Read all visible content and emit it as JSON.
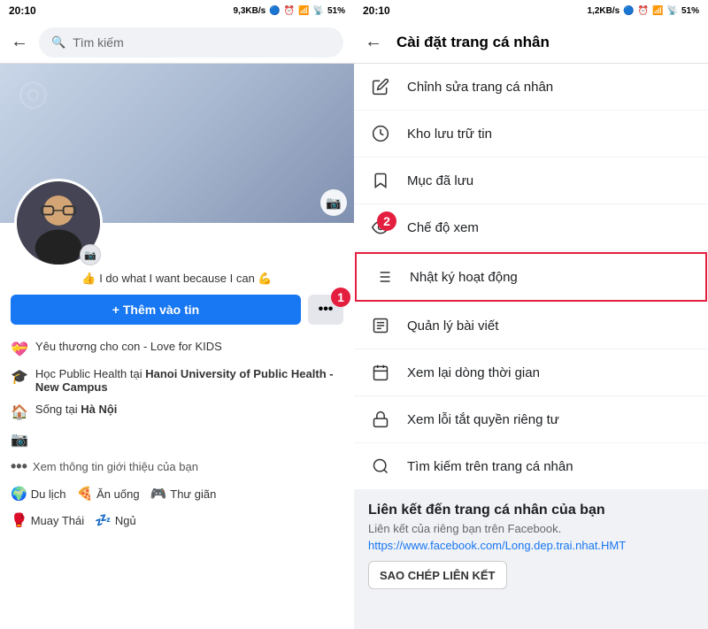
{
  "left": {
    "status_bar": {
      "time": "20:10",
      "network": "9,3KB/s",
      "battery": "51%"
    },
    "search": {
      "placeholder": "Tìm kiếm"
    },
    "profile": {
      "bio": "👍 I do what I want because I can 💪",
      "add_story_label": "+ Thêm vào tin",
      "more_label": "•••",
      "info": [
        {
          "icon": "💝",
          "text": "Yêu thương cho con - Love for KIDS",
          "bold": false
        },
        {
          "icon": "🎓",
          "text_prefix": "Học Public Health tại ",
          "text_bold": "Hanoi University of Public Health - New Campus",
          "bold": true
        },
        {
          "icon": "🏠",
          "text_prefix": "Sống tại ",
          "text_bold": "Hà Nội",
          "bold": true
        },
        {
          "icon": "📷",
          "text": "",
          "bold": false
        }
      ],
      "more_info_label": "Xem thông tin giới thiệu của bạn",
      "interests": [
        {
          "icon": "🌍",
          "label": "Du lịch"
        },
        {
          "icon": "🍕",
          "label": "Ăn uống"
        },
        {
          "icon": "🎮",
          "label": "Thư giãn"
        }
      ],
      "interests2": [
        {
          "icon": "🥊",
          "label": "Muay Thái"
        },
        {
          "icon": "💤",
          "label": "Ngủ"
        }
      ]
    },
    "badge_1": "1"
  },
  "right": {
    "status_bar": {
      "time": "20:10",
      "network": "1,2KB/s",
      "battery": "51%"
    },
    "header": {
      "title": "Cài đặt trang cá nhân"
    },
    "menu_items": [
      {
        "id": "edit",
        "icon": "pencil",
        "label": "Chỉnh sửa trang cá nhân"
      },
      {
        "id": "archive",
        "icon": "clock",
        "label": "Kho lưu trữ tin"
      },
      {
        "id": "saved",
        "icon": "bookmark",
        "label": "Mục đã lưu"
      },
      {
        "id": "view_mode",
        "icon": "eye",
        "label": "Chế độ xem"
      },
      {
        "id": "activity_log",
        "icon": "list",
        "label": "Nhật ký hoạt động",
        "highlighted": true
      },
      {
        "id": "manage_posts",
        "icon": "document",
        "label": "Quản lý bài viết"
      },
      {
        "id": "review_timeline",
        "icon": "calendar",
        "label": "Xem lại dòng thời gian"
      },
      {
        "id": "privacy",
        "icon": "lock",
        "label": "Xem lỗi tắt quyền riêng tư"
      },
      {
        "id": "search_profile",
        "icon": "search",
        "label": "Tìm kiếm trên trang cá nhân"
      }
    ],
    "link_section": {
      "title": "Liên kết đến trang cá nhân của bạn",
      "description": "Liên kết của riêng bạn trên Facebook.",
      "url": "https://www.facebook.com/Long.dep.trai.nhat.HMT",
      "copy_label": "SAO CHÉP LIÊN KẾT"
    },
    "badge_2": "2"
  }
}
